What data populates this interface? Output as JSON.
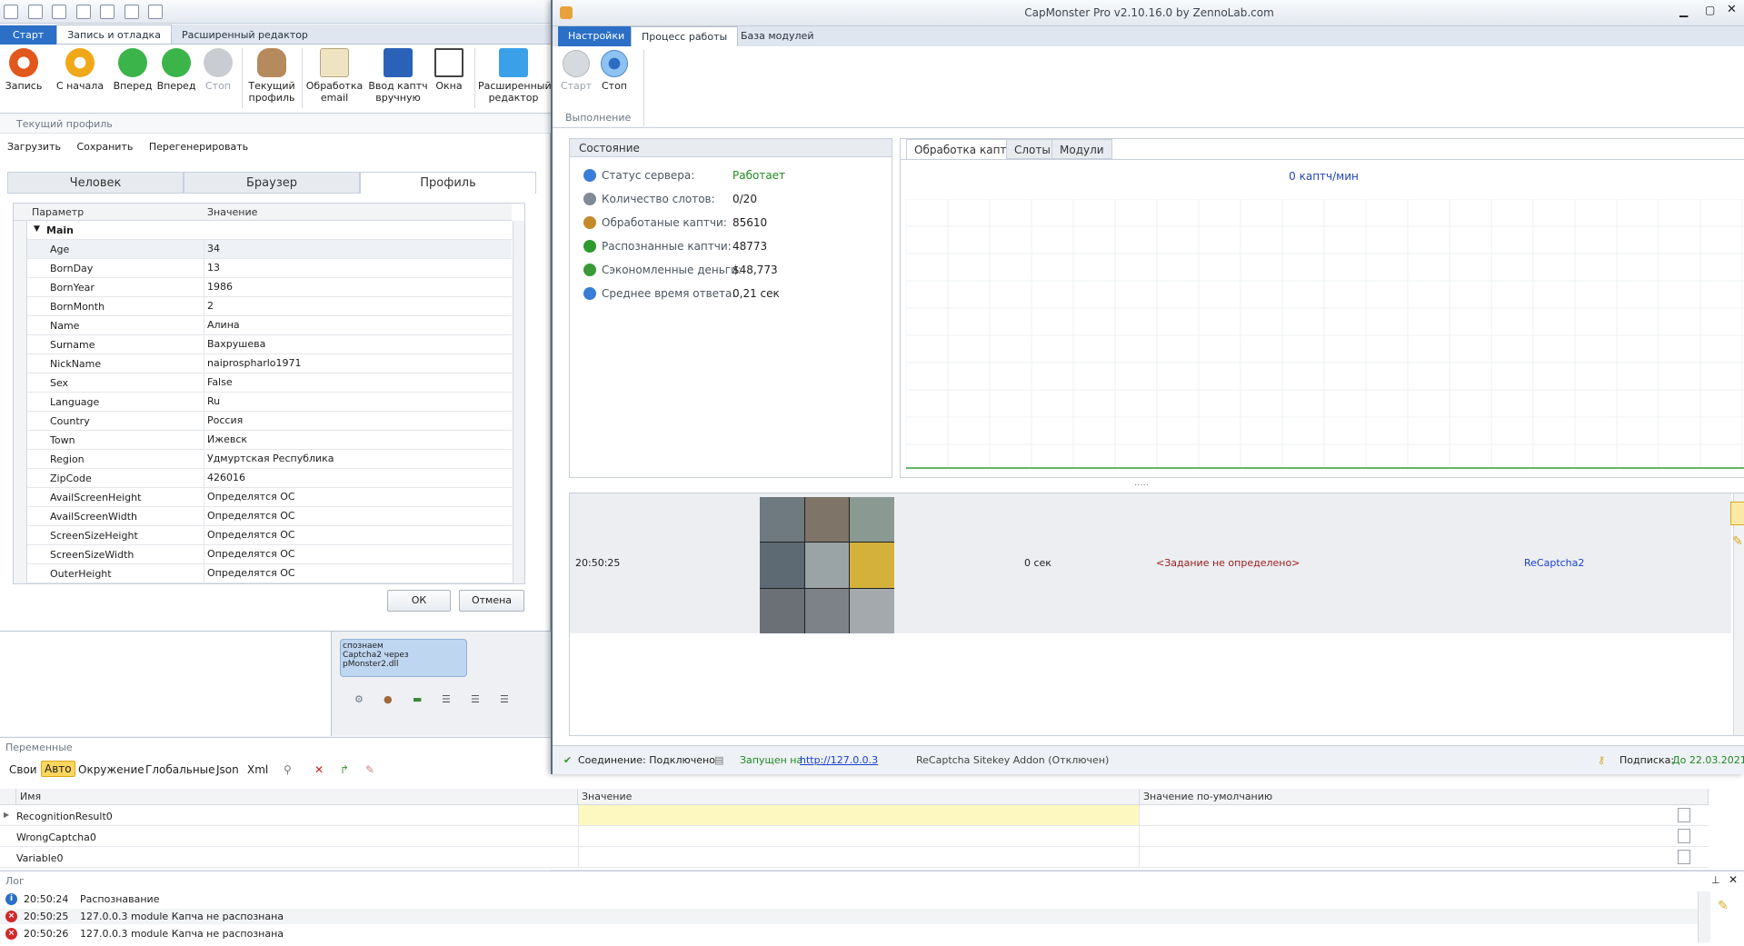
{
  "left_app": {
    "ribbon_tabs": [
      "Старт",
      "Запись и отладка",
      "Расширенный редактор"
    ],
    "ribbon_buttons": [
      {
        "label": "Запись",
        "icon": "record-icon"
      },
      {
        "label": "С начала",
        "icon": "restart-icon"
      },
      {
        "label": "Вперед",
        "icon": "play-icon"
      },
      {
        "label": "Вперед",
        "icon": "play-step-icon"
      },
      {
        "label": "Стоп",
        "icon": "stop-icon"
      },
      {
        "label": "Текущий профиль",
        "icon": "user-icon"
      },
      {
        "label": "Обработка email",
        "icon": "mail-icon"
      },
      {
        "label": "Ввод каптч вручную",
        "icon": "captcha-icon"
      },
      {
        "label": "Окна",
        "icon": "windows-icon"
      },
      {
        "label": "Расширенный редактор",
        "icon": "editor-icon"
      }
    ],
    "profile": {
      "header": "Текущий профиль",
      "toolbar": [
        "Загрузить",
        "Сохранить",
        "Перегенерировать"
      ],
      "tabs": [
        "Человек",
        "Браузер",
        "Профиль"
      ],
      "col_param": "Параметр",
      "col_value": "Значение",
      "group": "Main",
      "rows": [
        [
          "Age",
          "34"
        ],
        [
          "BornDay",
          "13"
        ],
        [
          "BornYear",
          "1986"
        ],
        [
          "BornMonth",
          "2"
        ],
        [
          "Name",
          "Алина"
        ],
        [
          "Surname",
          "Вахрушева"
        ],
        [
          "NickName",
          "naiprospharlo1971"
        ],
        [
          "Sex",
          "False"
        ],
        [
          "Language",
          "Ru"
        ],
        [
          "Country",
          "Россия"
        ],
        [
          "Town",
          "Ижевск"
        ],
        [
          "Region",
          "Удмуртская Республика"
        ],
        [
          "ZipCode",
          "426016"
        ],
        [
          "AvailScreenHeight",
          "Определятся ОС"
        ],
        [
          "AvailScreenWidth",
          "Определятся ОС"
        ],
        [
          "ScreenSizeHeight",
          "Определятся ОС"
        ],
        [
          "ScreenSizeWidth",
          "Определятся ОС"
        ],
        [
          "OuterHeight",
          "Определятся ОС"
        ]
      ],
      "ok": "ОК",
      "cancel": "Отмена"
    },
    "workspace_node_text": "спознаем\nCaptcha2 через\npMonster2.dll"
  },
  "variables": {
    "title": "Переменные",
    "tabs": [
      "Свои",
      "Авто",
      "Окружение",
      "Глобальные",
      "Json",
      "Xml"
    ],
    "active_tab": "Авто",
    "col_name": "Имя",
    "col_value": "Значение",
    "col_default": "Значение по-умолчанию",
    "rows": [
      "RecognitionResult0",
      "WrongCaptcha0",
      "Variable0"
    ]
  },
  "log": {
    "title": "Лог",
    "rows": [
      {
        "time": "20:50:24",
        "text": "Распознавание",
        "level": "info"
      },
      {
        "time": "20:50:25",
        "text": "127.0.0.3 module Капча не распознана",
        "level": "error"
      },
      {
        "time": "20:50:26",
        "text": "127.0.0.3 module Капча не распознана",
        "level": "error"
      }
    ]
  },
  "capmonster": {
    "title": "CapMonster Pro v2.10.16.0 by ZennoLab.com",
    "tabs": [
      "Настройки",
      "Процесс работы",
      "База модулей"
    ],
    "active_tab": "Процесс работы",
    "run_buttons": {
      "start": "Старт",
      "stop": "Стоп",
      "group": "Выполнение"
    },
    "status": {
      "header": "Состояние",
      "rows": [
        {
          "label": "Статус сервера:",
          "value": "Работает",
          "icon": "server-icon"
        },
        {
          "label": "Количество слотов:",
          "value": "0/20",
          "icon": "slots-icon"
        },
        {
          "label": "Обработаные каптчи:",
          "value": "85610",
          "icon": "processed-icon"
        },
        {
          "label": "Распознанные каптчи:",
          "value": "48773",
          "icon": "check-icon"
        },
        {
          "label": "Сэкономленные деньги:",
          "value": "$48,773",
          "icon": "money-icon"
        },
        {
          "label": "Среднее время ответа:",
          "value": "0,21 сек",
          "icon": "clock-icon"
        }
      ]
    },
    "inner_tabs": [
      "Обработка каптч",
      "Слоты",
      "Модули"
    ],
    "chart_rate": "0 каптч/мин",
    "queue": {
      "time": "20:50:25",
      "duration": "0 сек",
      "task": "<Задание не определено>",
      "type": "ReCaptcha2"
    },
    "statusbar": {
      "connection": "Соединение: Подключено",
      "running_on": "Запущен на",
      "url": "http://127.0.0.3",
      "addon": "ReCaptcha Sitekey Addon (Отключен)",
      "subscription_label": "Подписка:",
      "subscription_value": "До 22.03.2021"
    }
  },
  "colors": {
    "accent": "#2b70c6",
    "green": "#1f8a1f",
    "red": "#b3261e",
    "blue": "#1a3fcf"
  }
}
